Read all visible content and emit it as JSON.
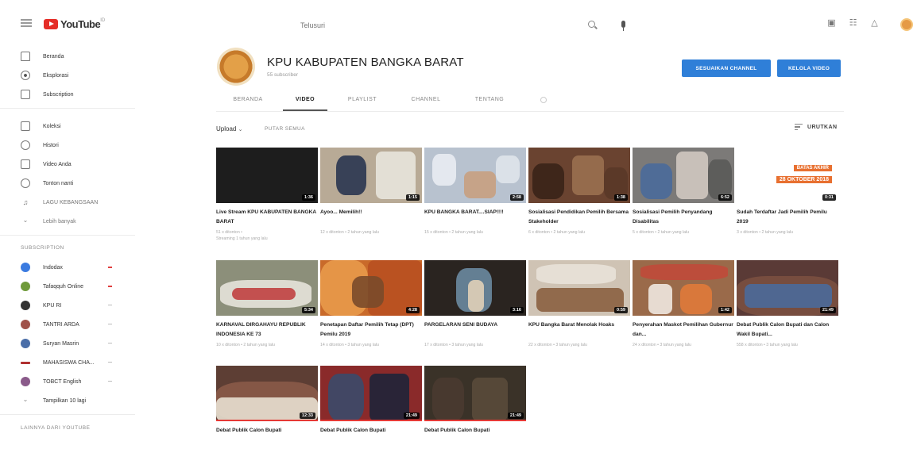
{
  "app": {
    "logo_text": "YouTube",
    "logo_sup": "ID"
  },
  "search": {
    "placeholder": "Telusuri"
  },
  "sidebar": {
    "main": [
      {
        "label": "Beranda",
        "icon": "home-icon"
      },
      {
        "label": "Eksplorasi",
        "icon": "compass-icon"
      },
      {
        "label": "Subscription",
        "icon": "subscription-icon"
      }
    ],
    "library": [
      {
        "label": "Koleksi",
        "icon": "library-icon"
      },
      {
        "label": "Histori",
        "icon": "history-icon"
      },
      {
        "label": "Video Anda",
        "icon": "your-videos-icon"
      },
      {
        "label": "Tonton nanti",
        "icon": "watch-later-icon"
      },
      {
        "label": "LAGU KEBANGSAAN",
        "icon": "playlist-music-icon"
      },
      {
        "label": "Lebih banyak",
        "icon": "chevron-down-icon"
      }
    ],
    "subscription_heading": "SUBSCRIPTION",
    "subscriptions": [
      {
        "label": "Indodax",
        "color": "#3b7be0"
      },
      {
        "label": "Tafaqquh Online",
        "color": "#6f9a3a"
      },
      {
        "label": "KPU RI",
        "color": "#333333"
      },
      {
        "label": "TANTRI ARDA",
        "color": "#a0524a"
      },
      {
        "label": "Suryan Masrin",
        "color": "#4a6ea8"
      },
      {
        "label": "MAHASISWA CHA...",
        "color": "#b03030"
      },
      {
        "label": "TOBCT English",
        "color": "#8a5a8a"
      }
    ],
    "show_more": "Tampilkan 10 lagi",
    "more_heading": "LAINNYA DARI YOUTUBE"
  },
  "channel": {
    "name": "KPU KABUPATEN BANGKA BARAT",
    "subscribers": "55 subscriber",
    "customize_button": "SESUAIKAN CHANNEL",
    "manage_button": "KELOLA VIDEO"
  },
  "tabs": [
    "BERANDA",
    "VIDEO",
    "PLAYLIST",
    "CHANNEL",
    "TENTANG"
  ],
  "filter": {
    "upload": "Upload",
    "play_all": "PUTAR SEMUA",
    "sort": "URUTKAN"
  },
  "videos": [
    {
      "title": "Live Stream KPU KABUPATEN BANGKA BARAT",
      "meta1": "51 x ditonton •",
      "meta2": "Streaming 1 tahun yang lalu",
      "duration": "1:36",
      "bg": "#1d1d1d"
    },
    {
      "title": "Ayoo... Memilih!!",
      "meta1": "12 x ditonton • 2 tahun yang lalu",
      "meta2": "",
      "duration": "1:15",
      "bg": "#b8aa96"
    },
    {
      "title": "KPU BANGKA BARAT....SIAP!!!!",
      "meta1": "15 x ditonton • 2 tahun yang lalu",
      "meta2": "",
      "duration": "2:58",
      "bg": "#b8c2cf"
    },
    {
      "title": "Sosialisasi Pendidikan Pemilih Bersama Stakeholder",
      "meta1": "6 x ditonton • 2 tahun yang lalu",
      "meta2": "",
      "duration": "1:38",
      "bg": "#6a4330"
    },
    {
      "title": "Sosialisasi Pemilih Penyandang Disabilitas",
      "meta1": "5 x ditonton • 2 tahun yang lalu",
      "meta2": "",
      "duration": "6:52",
      "bg": "#7c7a78"
    },
    {
      "title": "Sudah Terdaftar Jadi Pemilih Pemilu 2019",
      "meta1": "3 x ditonton • 2 tahun yang lalu",
      "meta2": "",
      "duration": "0:31",
      "bg": "#ffffff",
      "banner1": "BATAS AKHIR",
      "banner2": "28 OKTOBER 2018"
    },
    {
      "title": "KARNAVAL DIRGAHAYU REPUBLIK INDONESIA KE 73",
      "meta1": "10 x ditonton • 2 tahun yang lalu",
      "meta2": "",
      "duration": "5:34",
      "bg": "#8c8f7a"
    },
    {
      "title": "Penetapan Daftar Pemilih Tetap (DPT) Pemilu 2019",
      "meta1": "14 x ditonton • 3 tahun yang lalu",
      "meta2": "",
      "duration": "4:28",
      "bg": "#c96a2a"
    },
    {
      "title": "PARGELARAN SENI BUDAYA",
      "meta1": "17 x ditonton • 3 tahun yang lalu",
      "meta2": "",
      "duration": "3:16",
      "bg": "#2a2420"
    },
    {
      "title": "KPU Bangka Barat Menolak Hoaks",
      "meta1": "22 x ditonton • 3 tahun yang lalu",
      "meta2": "",
      "duration": "0:59",
      "bg": "#cfc3b4"
    },
    {
      "title": "Penyerahan Maskot Pemilihan Gubernur dan...",
      "meta1": "24 x ditonton • 3 tahun yang lalu",
      "meta2": "",
      "duration": "1:42",
      "bg": "#9a6a4a"
    },
    {
      "title": "Debat Publik Calon Bupati dan Calon Wakil Bupati...",
      "meta1": "558 x ditonton • 3 tahun yang lalu",
      "meta2": "",
      "duration": "21:49",
      "bg": "#5a3a36"
    },
    {
      "title": "Debat Publik Calon Bupati",
      "meta1": "",
      "meta2": "",
      "duration": "12:33",
      "bg": "#5d3e34"
    },
    {
      "title": "Debat Publik Calon Bupati",
      "meta1": "",
      "meta2": "",
      "duration": "21:49",
      "bg": "#8a2a2a"
    },
    {
      "title": "Debat Publik Calon Bupati",
      "meta1": "",
      "meta2": "",
      "duration": "21:49",
      "bg": "#3a3228"
    }
  ]
}
